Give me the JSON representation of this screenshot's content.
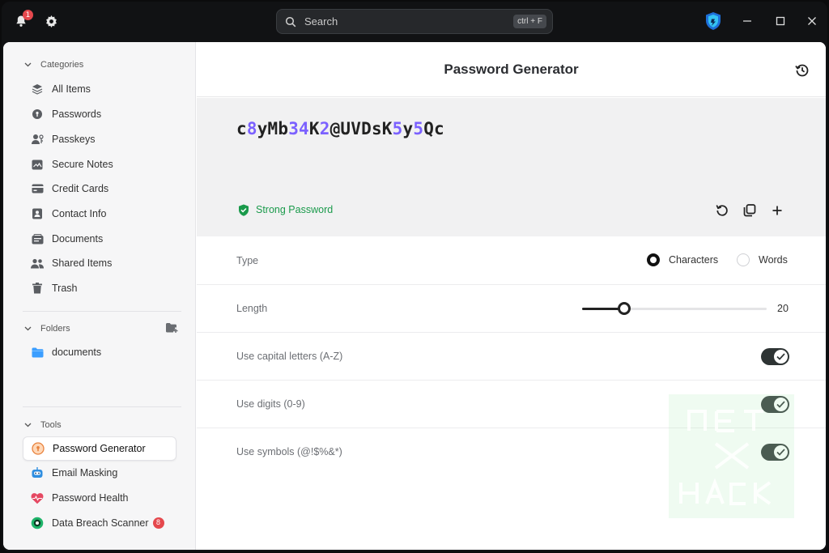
{
  "titlebar": {
    "notification_count": "1",
    "search_placeholder": "Search",
    "search_shortcut": "ctrl + F"
  },
  "sidebar": {
    "categories_label": "Categories",
    "categories": [
      {
        "label": "All Items",
        "icon": "layers-icon"
      },
      {
        "label": "Passwords",
        "icon": "key-icon"
      },
      {
        "label": "Passkeys",
        "icon": "passkey-icon"
      },
      {
        "label": "Secure Notes",
        "icon": "note-icon"
      },
      {
        "label": "Credit Cards",
        "icon": "credit-card-icon"
      },
      {
        "label": "Contact Info",
        "icon": "contact-icon"
      },
      {
        "label": "Documents",
        "icon": "documents-icon"
      },
      {
        "label": "Shared Items",
        "icon": "people-icon"
      },
      {
        "label": "Trash",
        "icon": "trash-icon"
      }
    ],
    "folders_label": "Folders",
    "folders": [
      {
        "label": "documents",
        "color": "#3b9eff"
      }
    ],
    "tools_label": "Tools",
    "tools": [
      {
        "label": "Password Generator",
        "active": true
      },
      {
        "label": "Email Masking"
      },
      {
        "label": "Password Health"
      },
      {
        "label": "Data Breach Scanner",
        "badge": "8"
      }
    ]
  },
  "main": {
    "title": "Password Generator",
    "password_segments": [
      {
        "t": "c",
        "digit": false
      },
      {
        "t": "8",
        "digit": true
      },
      {
        "t": "yMb",
        "digit": false
      },
      {
        "t": "34",
        "digit": true
      },
      {
        "t": "K",
        "digit": false
      },
      {
        "t": "2",
        "digit": true
      },
      {
        "t": "@UVDsK",
        "digit": false
      },
      {
        "t": "5",
        "digit": true
      },
      {
        "t": "y",
        "digit": false
      },
      {
        "t": "5",
        "digit": true
      },
      {
        "t": "Qc",
        "digit": false
      }
    ],
    "strength_label": "Strong Password",
    "type_label": "Type",
    "type_options": [
      "Characters",
      "Words"
    ],
    "type_selected": "Characters",
    "length_label": "Length",
    "length_value": "20",
    "length_fraction": 0.23,
    "options": [
      {
        "label": "Use capital letters (A-Z)",
        "enabled": true
      },
      {
        "label": "Use digits (0-9)",
        "enabled": true
      },
      {
        "label": "Use symbols (@!$%&*)",
        "enabled": true
      }
    ]
  },
  "colors": {
    "accent_purple": "#7b61ff",
    "strong_green": "#1a9a4b",
    "badge_red": "#e5484d"
  }
}
